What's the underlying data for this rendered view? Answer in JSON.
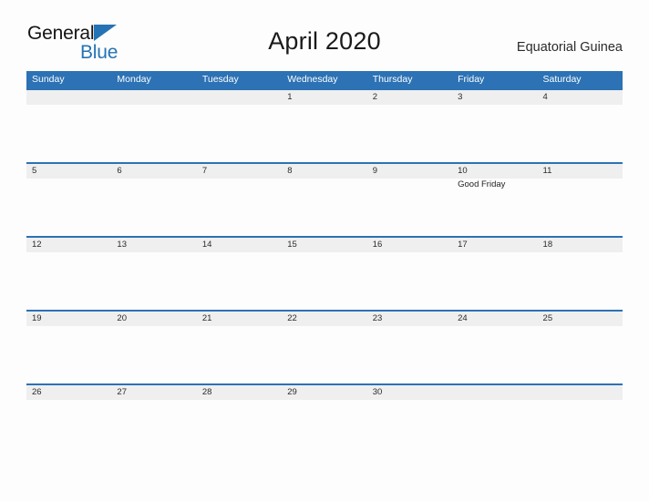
{
  "brand": {
    "name_part1": "General",
    "name_part2": "Blue",
    "triangle_icon": "triangle-icon",
    "color_black": "#141414",
    "color_blue": "#2573b5"
  },
  "header": {
    "title": "April 2020",
    "region": "Equatorial Guinea"
  },
  "colors": {
    "header_blue": "#2c72b5",
    "row_band_gray": "#efefef",
    "page_background": "#fdfdfd",
    "text_dark": "#2a2a2a"
  },
  "calendar": {
    "month": "April",
    "year": "2020",
    "weekday_headers": [
      "Sunday",
      "Monday",
      "Tuesday",
      "Wednesday",
      "Thursday",
      "Friday",
      "Saturday"
    ],
    "weeks": [
      {
        "days": [
          {
            "date": "",
            "event": ""
          },
          {
            "date": "",
            "event": ""
          },
          {
            "date": "",
            "event": ""
          },
          {
            "date": "1",
            "event": ""
          },
          {
            "date": "2",
            "event": ""
          },
          {
            "date": "3",
            "event": ""
          },
          {
            "date": "4",
            "event": ""
          }
        ]
      },
      {
        "days": [
          {
            "date": "5",
            "event": ""
          },
          {
            "date": "6",
            "event": ""
          },
          {
            "date": "7",
            "event": ""
          },
          {
            "date": "8",
            "event": ""
          },
          {
            "date": "9",
            "event": ""
          },
          {
            "date": "10",
            "event": "Good Friday"
          },
          {
            "date": "11",
            "event": ""
          }
        ]
      },
      {
        "days": [
          {
            "date": "12",
            "event": ""
          },
          {
            "date": "13",
            "event": ""
          },
          {
            "date": "14",
            "event": ""
          },
          {
            "date": "15",
            "event": ""
          },
          {
            "date": "16",
            "event": ""
          },
          {
            "date": "17",
            "event": ""
          },
          {
            "date": "18",
            "event": ""
          }
        ]
      },
      {
        "days": [
          {
            "date": "19",
            "event": ""
          },
          {
            "date": "20",
            "event": ""
          },
          {
            "date": "21",
            "event": ""
          },
          {
            "date": "22",
            "event": ""
          },
          {
            "date": "23",
            "event": ""
          },
          {
            "date": "24",
            "event": ""
          },
          {
            "date": "25",
            "event": ""
          }
        ]
      },
      {
        "days": [
          {
            "date": "26",
            "event": ""
          },
          {
            "date": "27",
            "event": ""
          },
          {
            "date": "28",
            "event": ""
          },
          {
            "date": "29",
            "event": ""
          },
          {
            "date": "30",
            "event": ""
          },
          {
            "date": "",
            "event": ""
          },
          {
            "date": "",
            "event": ""
          }
        ]
      }
    ]
  }
}
